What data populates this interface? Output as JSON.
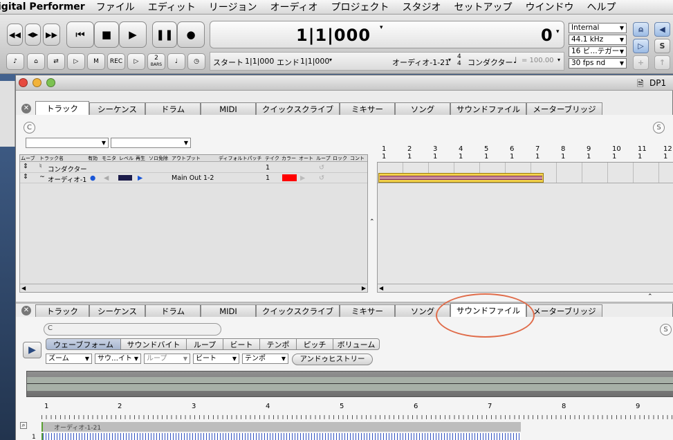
{
  "menubar": {
    "app_name": "igital Performer",
    "items": [
      "ファイル",
      "エディット",
      "リージョン",
      "オーディオ",
      "プロジェクト",
      "スタジオ",
      "セットアップ",
      "ウインドウ",
      "ヘルプ"
    ]
  },
  "transport": {
    "counter": "1|1|000",
    "counter_right": "0",
    "start_label": "スタート",
    "start_value": "1|1|000",
    "end_label": "エンド",
    "end_value": "1|1|000",
    "track_name": "オーディオ-1-21",
    "meter_top": "4",
    "meter_bottom": "4",
    "conductor_label": "コンダクター",
    "tempo": "= 100.00",
    "sync": "Internal",
    "sample_rate": "44.1 kHz",
    "bit_depth": "16 ビ…テガー",
    "fps": "30 fps nd",
    "bars_label": "2",
    "bars_sub": "BARS",
    "s_label": "S"
  },
  "window": {
    "title": "DP1"
  },
  "tabs": [
    "トラック",
    "シーケンス",
    "ドラム",
    "MIDI",
    "クイックスクライブ",
    "ミキサー",
    "ソング",
    "サウンドファイル",
    "メーターブリッジ"
  ],
  "tracks": {
    "c_label": "C",
    "s_label": "S",
    "headers": [
      "ムーブ",
      "トラック名",
      "有効",
      "モニタ",
      "レベル",
      "再生",
      "ソロ免除",
      "アウトプット",
      "ディフォルトパッチ",
      "テイク",
      "カラー",
      "オート",
      "ループ",
      "ロック",
      "コント"
    ],
    "rows": [
      {
        "name": "コンダクター",
        "take": "1"
      },
      {
        "name": "オーディオ-1",
        "output": "Main Out 1-2",
        "take": "1"
      }
    ],
    "ruler_top": [
      "1",
      "2",
      "3",
      "4",
      "5",
      "6",
      "7",
      "8",
      "9",
      "10",
      "11",
      "12"
    ],
    "ruler_sub": [
      "1",
      "1",
      "1",
      "1",
      "1",
      "1",
      "1",
      "1",
      "1",
      "1",
      "1",
      "1"
    ]
  },
  "soundfile": {
    "c_label": "C",
    "s_label": "S",
    "segments": [
      "ウェーブフォーム",
      "サウンドバイト",
      "ループ",
      "ビート",
      "テンポ",
      "ピッチ",
      "ボリューム"
    ],
    "popups": [
      "ズーム",
      "サウ…イト",
      "ループ",
      "ビート",
      "テンポ"
    ],
    "history_btn": "アンドゥヒストリー",
    "ruler": [
      "1",
      "2",
      "3",
      "4",
      "5",
      "6",
      "7",
      "8",
      "9"
    ],
    "region_name": "オーディオ-1-21",
    "row_label": "1"
  },
  "colors": {
    "accent": "#e06c4a",
    "track_color": "#ff0000",
    "region": "#c78a9a"
  }
}
